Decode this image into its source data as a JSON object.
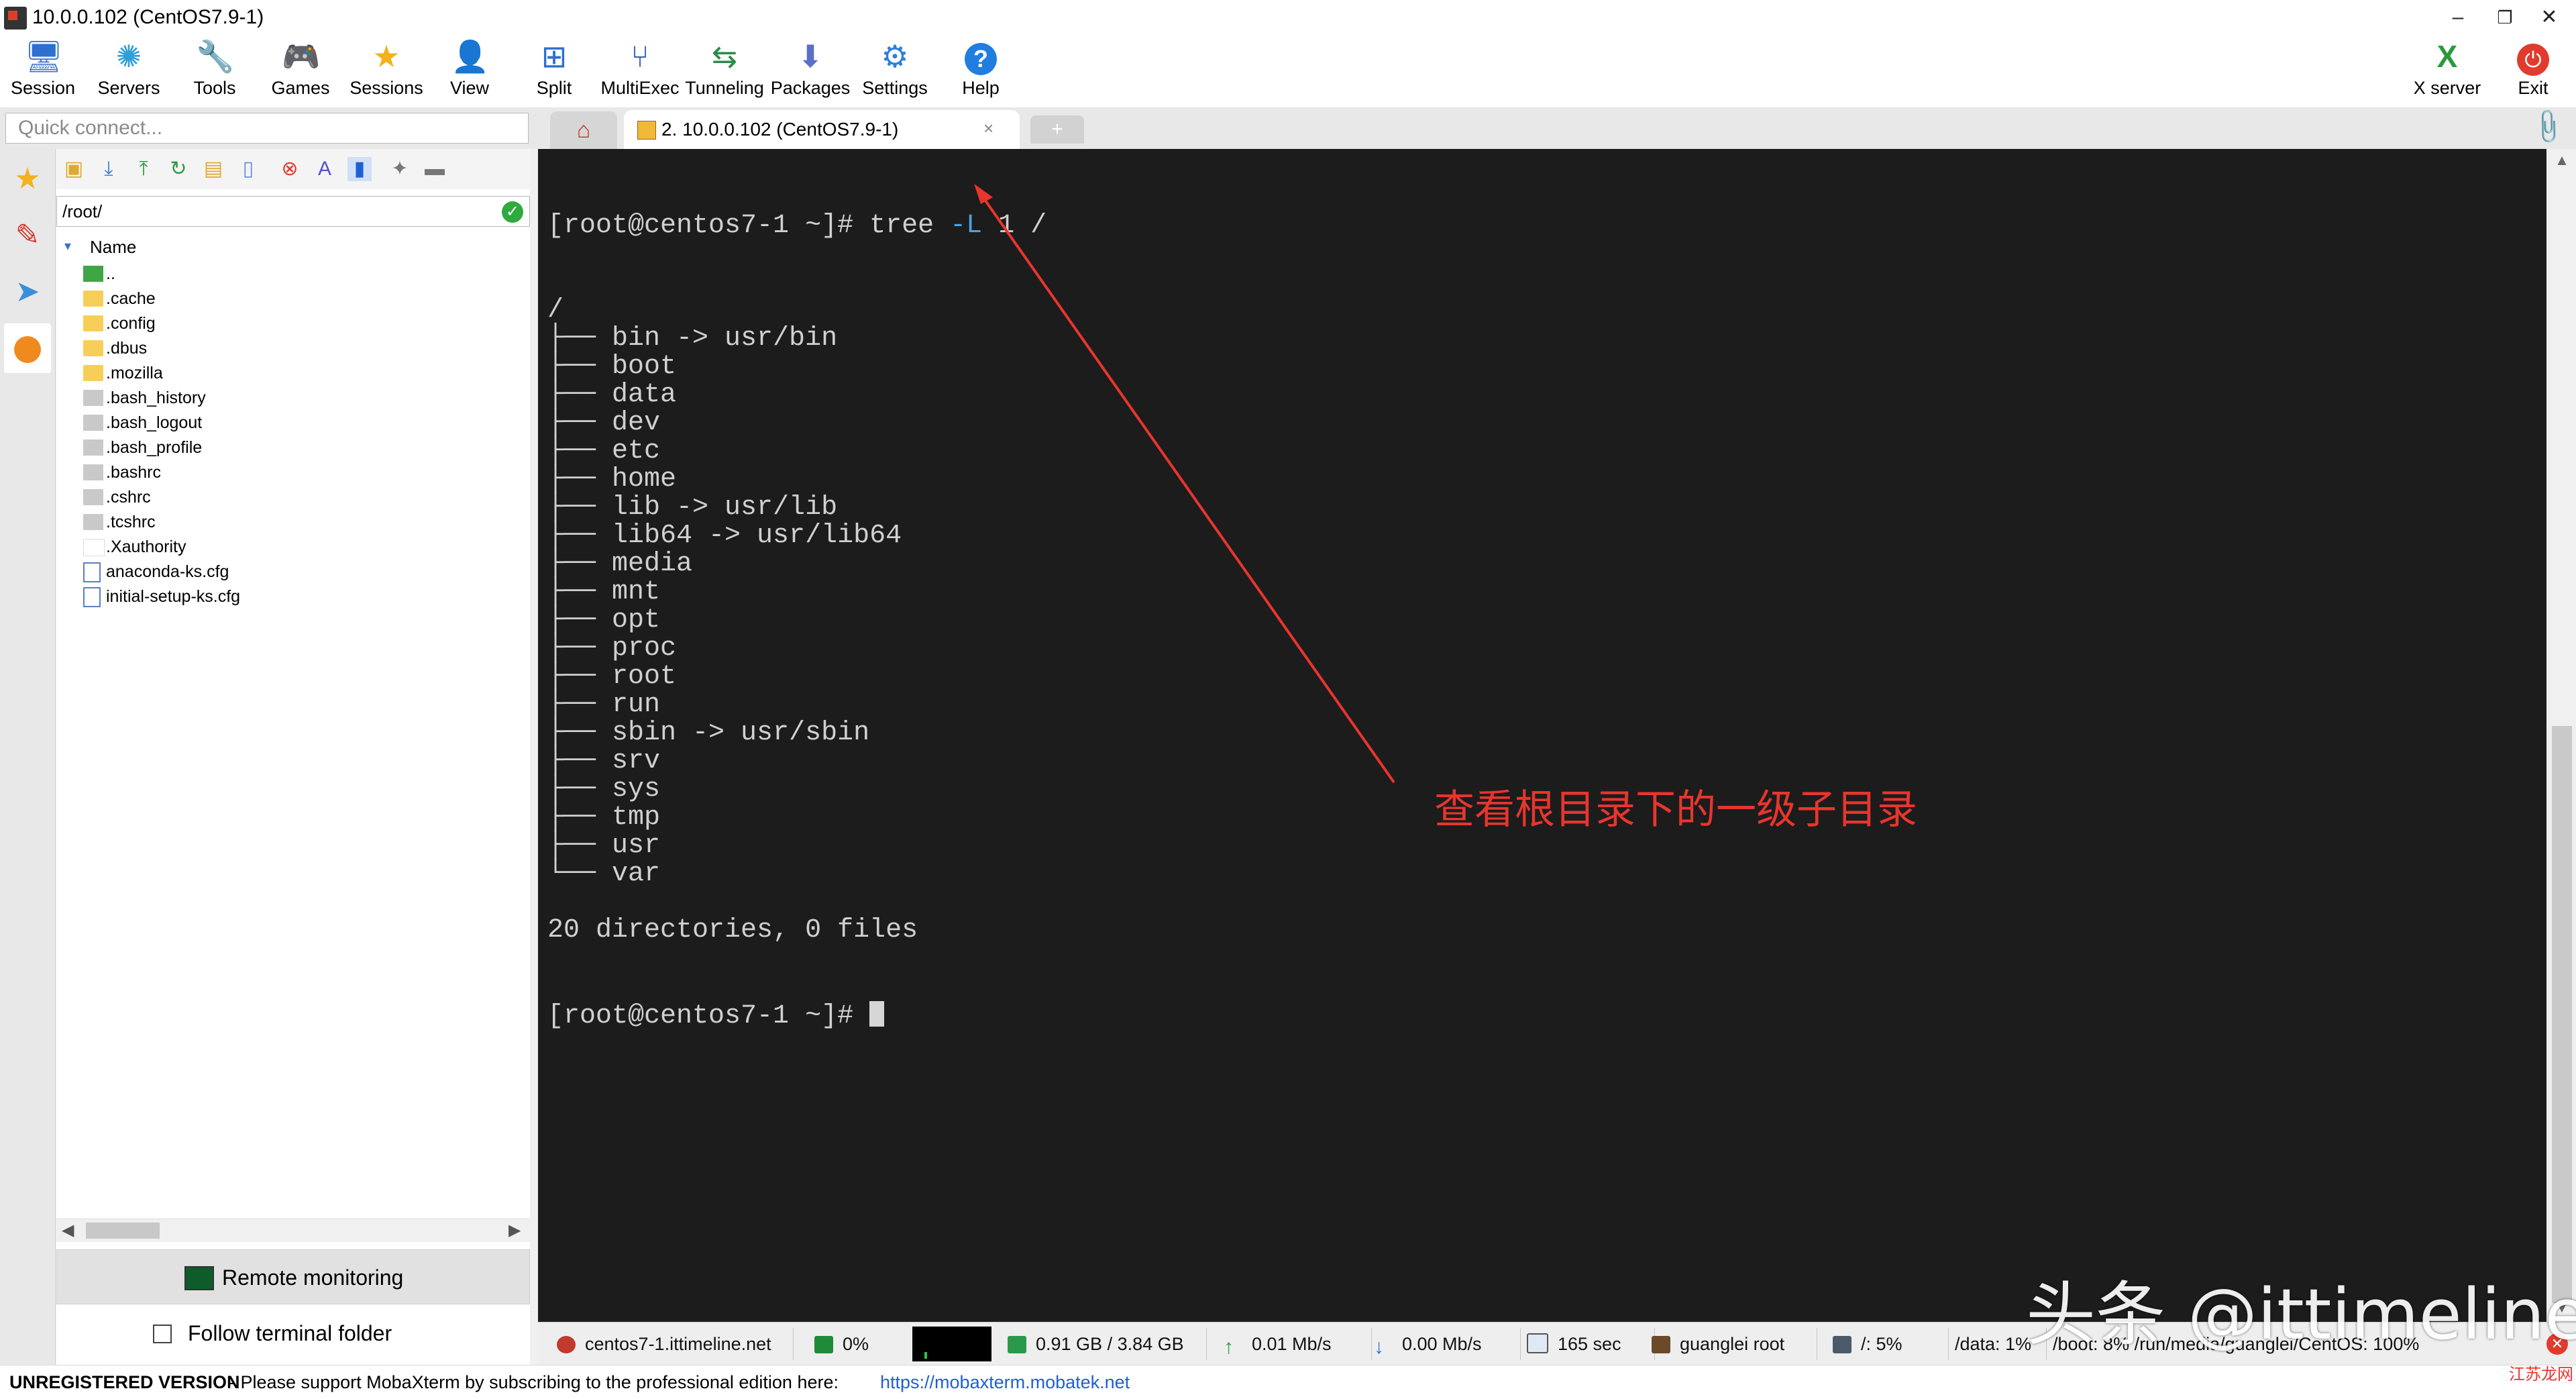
{
  "window": {
    "title": "10.0.0.102 (CentOS7.9-1)",
    "minimize": "–",
    "restore": "❐",
    "close": "✕"
  },
  "toolbar": {
    "items": [
      {
        "label": "Session",
        "icon": "session-icon"
      },
      {
        "label": "Servers",
        "icon": "servers-icon"
      },
      {
        "label": "Tools",
        "icon": "tools-icon"
      },
      {
        "label": "Games",
        "icon": "games-icon"
      },
      {
        "label": "Sessions",
        "icon": "star-icon"
      },
      {
        "label": "View",
        "icon": "view-icon"
      },
      {
        "label": "Split",
        "icon": "split-icon"
      },
      {
        "label": "MultiExec",
        "icon": "multiexec-icon"
      },
      {
        "label": "Tunneling",
        "icon": "tunneling-icon"
      },
      {
        "label": "Packages",
        "icon": "packages-icon"
      },
      {
        "label": "Settings",
        "icon": "settings-icon"
      },
      {
        "label": "Help",
        "icon": "help-icon"
      }
    ],
    "xserver_label": "X server",
    "exit_label": "Exit"
  },
  "quick_connect": {
    "placeholder": "Quick connect..."
  },
  "tabs": {
    "session_label": "2. 10.0.0.102 (CentOS7.9-1)",
    "close": "×",
    "new": "+"
  },
  "sftp": {
    "path": "/root/",
    "column_name": "Name",
    "files": [
      {
        "name": "..",
        "kind": "updir"
      },
      {
        "name": ".cache",
        "kind": "folder"
      },
      {
        "name": ".config",
        "kind": "folder"
      },
      {
        "name": ".dbus",
        "kind": "folder"
      },
      {
        "name": ".mozilla",
        "kind": "folder"
      },
      {
        "name": ".bash_history",
        "kind": "file"
      },
      {
        "name": ".bash_logout",
        "kind": "file"
      },
      {
        "name": ".bash_profile",
        "kind": "file"
      },
      {
        "name": ".bashrc",
        "kind": "file"
      },
      {
        "name": ".cshrc",
        "kind": "file"
      },
      {
        "name": ".tcshrc",
        "kind": "file"
      },
      {
        "name": ".Xauthority",
        "kind": "blank"
      },
      {
        "name": "anaconda-ks.cfg",
        "kind": "doc"
      },
      {
        "name": "initial-setup-ks.cfg",
        "kind": "doc"
      }
    ],
    "remote_monitoring": "Remote monitoring",
    "follow_terminal": "Follow terminal folder"
  },
  "terminal": {
    "prompt": "[root@centos7-1 ~]# ",
    "command_pre": "tree ",
    "command_flag": "-L",
    "command_post": " 1 /",
    "lines": [
      "/",
      "├── bin -> usr/bin",
      "├── boot",
      "├── data",
      "├── dev",
      "├── etc",
      "├── home",
      "├── lib -> usr/lib",
      "├── lib64 -> usr/lib64",
      "├── media",
      "├── mnt",
      "├── opt",
      "├── proc",
      "├── root",
      "├── run",
      "├── sbin -> usr/sbin",
      "├── srv",
      "├── sys",
      "├── tmp",
      "├── usr",
      "└── var",
      "",
      "20 directories, 0 files"
    ],
    "final_prompt": "[root@centos7-1 ~]# "
  },
  "annotation": {
    "text": "查看根目录下的一级子目录",
    "color": "#e8352d"
  },
  "statusbar": {
    "host": "centos7-1.ittimeline.net",
    "cpu": "0%",
    "memory": "0.91 GB / 3.84 GB",
    "upload": "0.01 Mb/s",
    "download": "0.00 Mb/s",
    "uptime": "165 sec",
    "users": "guanglei  root",
    "disk_root": "/: 5%",
    "disk_data": "/data: 1%",
    "disk_more": "/boot: 8%   /run/media/guanglei/CentOS: 100%"
  },
  "bottom": {
    "unregistered": "UNREGISTERED VERSION",
    "support": "-  Please support MobaXterm by subscribing to the professional edition here:",
    "link": "https://mobaxterm.mobatek.net"
  },
  "watermark": {
    "text": "头条 @ittimeline",
    "small": "江苏龙网"
  },
  "colors": {
    "terminal_bg": "#1c1c1c",
    "terminal_fg": "#d0d0d0",
    "flag": "#4aa3e0",
    "accent": "#3a6fd8"
  }
}
